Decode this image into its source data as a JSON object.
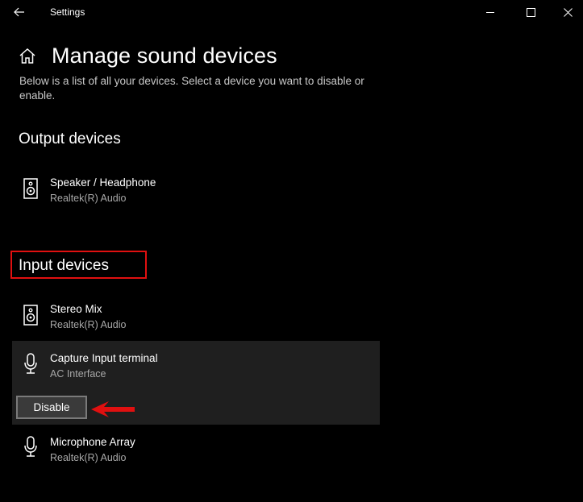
{
  "titlebar": {
    "app_title": "Settings"
  },
  "header": {
    "title": "Manage sound devices",
    "description": "Below is a list of all your devices. Select a device you want to disable or enable."
  },
  "output_section": {
    "title": "Output devices",
    "devices": [
      {
        "name": "Speaker / Headphone",
        "sub": "Realtek(R) Audio",
        "icon": "speaker-icon"
      }
    ]
  },
  "input_section": {
    "title": "Input devices",
    "devices": [
      {
        "name": "Stereo Mix",
        "sub": "Realtek(R) Audio",
        "icon": "speaker-icon"
      },
      {
        "name": "Capture Input terminal",
        "sub": "AC Interface",
        "icon": "microphone-icon",
        "selected": true,
        "action_label": "Disable"
      },
      {
        "name": "Microphone Array",
        "sub": "Realtek(R) Audio",
        "icon": "microphone-icon"
      }
    ]
  },
  "colors": {
    "background": "#000000",
    "selected_item_bg": "#1f1f1f",
    "annotation_red": "#e01010",
    "secondary_text": "#a8a8a8"
  }
}
